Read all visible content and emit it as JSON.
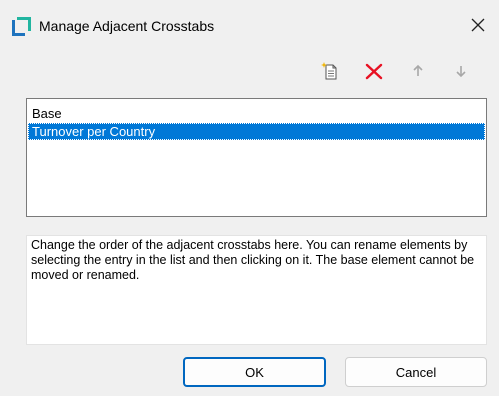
{
  "window": {
    "title": "Manage Adjacent Crosstabs",
    "icon": "crosstab-app-icon",
    "close_glyph": "✕"
  },
  "toolbar": {
    "items": [
      {
        "name": "new-item-icon",
        "enabled": true
      },
      {
        "name": "delete-icon",
        "enabled": true,
        "color": "#e81123"
      },
      {
        "name": "arrow-up-icon",
        "enabled": false
      },
      {
        "name": "arrow-down-icon",
        "enabled": false
      }
    ]
  },
  "list": {
    "items": [
      {
        "label": "Base",
        "selected": false
      },
      {
        "label": "Turnover per Country",
        "selected": true
      }
    ],
    "selection_color": "#0078d7"
  },
  "description": {
    "text": "Change the order of the adjacent crosstabs here. You can rename elements by selecting the entry in the list and then clicking on it. The base element cannot be moved or renamed."
  },
  "buttons": {
    "ok_label": "OK",
    "cancel_label": "Cancel"
  },
  "colors": {
    "accent": "#0067c0",
    "app_icon_teal": "#21b5a0",
    "app_icon_blue": "#1e73be"
  }
}
